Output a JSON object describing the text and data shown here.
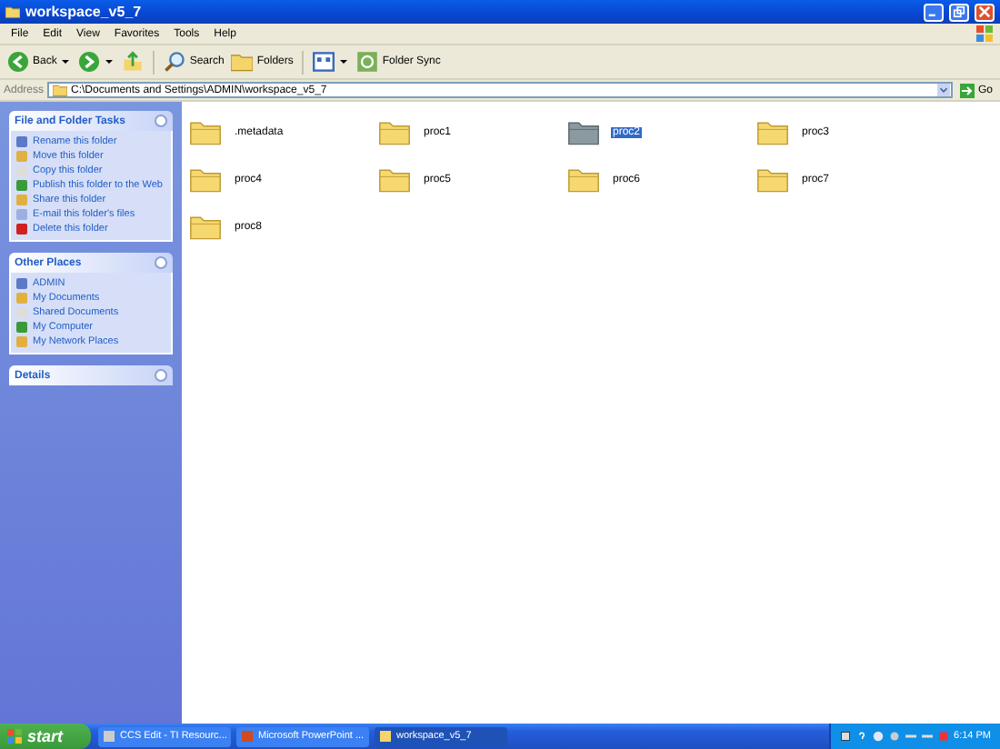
{
  "window": {
    "title": "workspace_v5_7"
  },
  "menu": [
    "File",
    "Edit",
    "View",
    "Favorites",
    "Tools",
    "Help"
  ],
  "toolbar": [
    {
      "kind": "back",
      "label": "Back"
    },
    {
      "kind": "forward"
    },
    {
      "kind": "up"
    },
    {
      "kind": "search",
      "label": "Search"
    },
    {
      "kind": "folders",
      "label": "Folders"
    },
    {
      "kind": "views"
    },
    {
      "kind": "sync",
      "label": "Folder Sync"
    }
  ],
  "address": {
    "label": "Address",
    "value": "C:\\Documents and Settings\\ADMIN\\workspace_v5_7",
    "go": "Go"
  },
  "panels": [
    {
      "title": "File and Folder Tasks",
      "items": [
        "Rename this folder",
        "Move this folder",
        "Copy this folder",
        "Publish this folder to the Web",
        "Share this folder",
        "E-mail this folder's files",
        "Delete this folder"
      ]
    },
    {
      "title": "Other Places",
      "items": [
        "ADMIN",
        "My Documents",
        "Shared Documents",
        "My Computer",
        "My Network Places"
      ]
    },
    {
      "title": "Details"
    }
  ],
  "files": [
    {
      "name": ".metadata",
      "selected": false
    },
    {
      "name": "proc1",
      "selected": false
    },
    {
      "name": "proc2",
      "selected": true
    },
    {
      "name": "proc3",
      "selected": false
    },
    {
      "name": "proc4",
      "selected": false
    },
    {
      "name": "proc5",
      "selected": false
    },
    {
      "name": "proc6",
      "selected": false
    },
    {
      "name": "proc7",
      "selected": false
    },
    {
      "name": "proc8",
      "selected": false
    }
  ],
  "taskbar": {
    "start": "start",
    "tasks": [
      {
        "label": "CCS Edit - TI Resourc...",
        "selected": false
      },
      {
        "label": "Microsoft PowerPoint ...",
        "selected": false
      },
      {
        "label": "workspace_v5_7",
        "selected": true
      }
    ],
    "clock": "6:14 PM"
  }
}
